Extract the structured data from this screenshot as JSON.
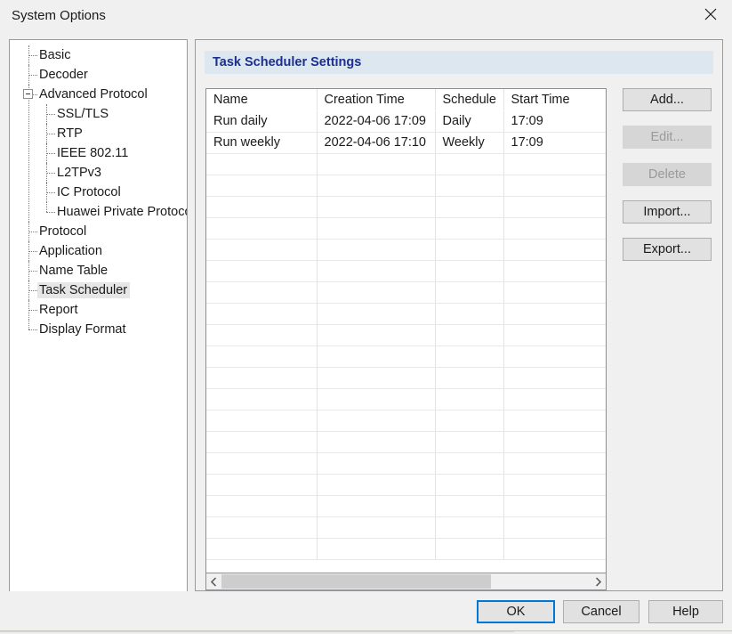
{
  "window": {
    "title": "System Options",
    "close_icon": "close-icon"
  },
  "accent": {
    "focus_border": "#0078d7",
    "header_band": "#dde7f0",
    "header_text": "#1b2f8f",
    "selection": "#e6e6e6"
  },
  "tree": {
    "items": [
      {
        "label": "Basic",
        "level": 1,
        "expander": false,
        "selected": false
      },
      {
        "label": "Decoder",
        "level": 1,
        "expander": false,
        "selected": false
      },
      {
        "label": "Advanced Protocol",
        "level": 1,
        "expander": true,
        "expanded": true,
        "selected": false
      },
      {
        "label": "SSL/TLS",
        "level": 2,
        "expander": false,
        "selected": false
      },
      {
        "label": "RTP",
        "level": 2,
        "expander": false,
        "selected": false
      },
      {
        "label": "IEEE 802.11",
        "level": 2,
        "expander": false,
        "selected": false
      },
      {
        "label": "L2TPv3",
        "level": 2,
        "expander": false,
        "selected": false
      },
      {
        "label": "IC Protocol",
        "level": 2,
        "expander": false,
        "selected": false
      },
      {
        "label": "Huawei Private Protoco",
        "level": 2,
        "expander": false,
        "selected": false,
        "last": true
      },
      {
        "label": "Protocol",
        "level": 1,
        "expander": false,
        "selected": false
      },
      {
        "label": "Application",
        "level": 1,
        "expander": false,
        "selected": false
      },
      {
        "label": "Name Table",
        "level": 1,
        "expander": false,
        "selected": false
      },
      {
        "label": "Task Scheduler",
        "level": 1,
        "expander": false,
        "selected": true
      },
      {
        "label": "Report",
        "level": 1,
        "expander": false,
        "selected": false
      },
      {
        "label": "Display Format",
        "level": 1,
        "expander": false,
        "selected": false,
        "last": true
      }
    ]
  },
  "main": {
    "section_title": "Task Scheduler Settings",
    "table": {
      "columns": [
        "Name",
        "Creation Time",
        "Schedule",
        "Start Time"
      ],
      "rows": [
        [
          "Run daily",
          "2022-04-06 17:09",
          "Daily",
          "17:09"
        ],
        [
          "Run weekly",
          "2022-04-06 17:10",
          "Weekly",
          "17:09"
        ]
      ],
      "empty_row_count": 19
    },
    "scrollbar": {
      "left_arrow_icon": "chevron-left-icon",
      "right_arrow_icon": "chevron-right-icon",
      "thumb_fraction": "73%"
    },
    "buttons": [
      {
        "label": "Add...",
        "enabled": true
      },
      {
        "label": "Edit...",
        "enabled": false
      },
      {
        "label": "Delete",
        "enabled": false
      },
      {
        "label": "Import...",
        "enabled": true
      },
      {
        "label": "Export...",
        "enabled": true
      }
    ]
  },
  "footer": {
    "ok_label": "OK",
    "cancel_label": "Cancel",
    "help_label": "Help"
  }
}
